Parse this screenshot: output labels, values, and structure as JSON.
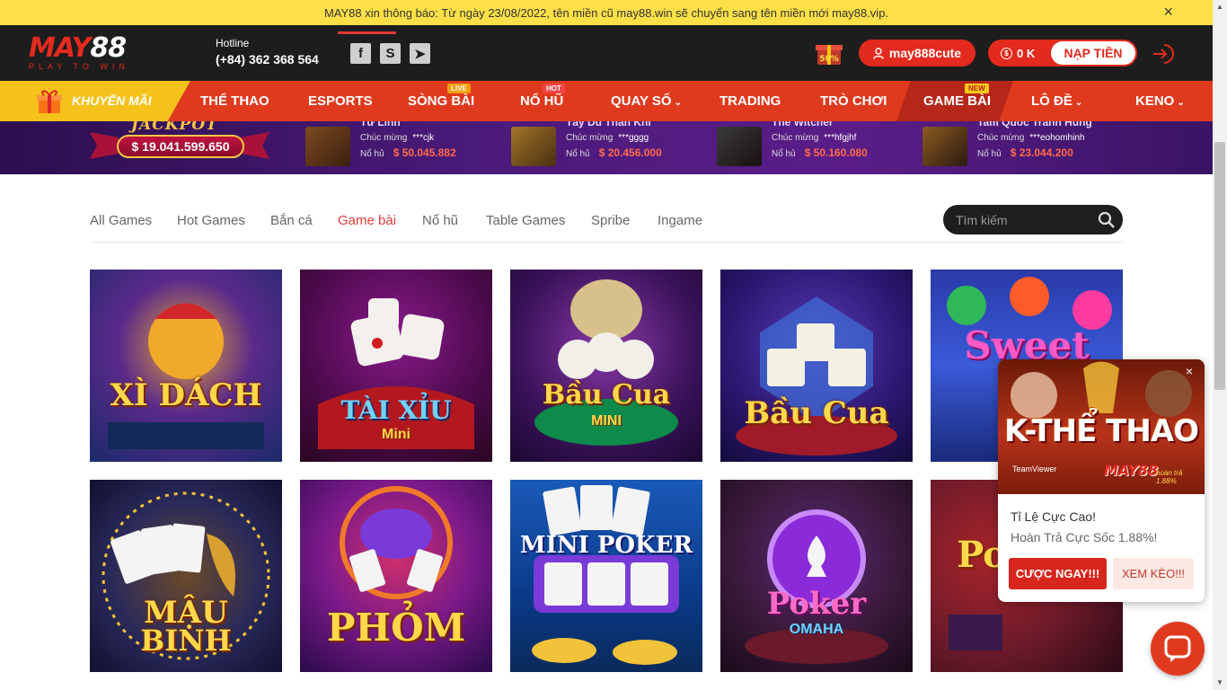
{
  "notice": {
    "text": "MAY88 xin thông báo: Từ ngày 23/08/2022, tên miền cũ may88.win sẽ chuyển sang tên miền mới may88.vip.",
    "close": "×"
  },
  "header": {
    "logo_main": "MAY",
    "logo_num": "88",
    "logo_tag": "PLAY TO WIN",
    "hotline_label": "Hotline",
    "hotline_number": "(+84) 362 368 564",
    "social": [
      "f",
      "S",
      "➤"
    ],
    "promo_badge": "50%",
    "username": "may888cute",
    "balance": "0 K",
    "coin_symbol": "$",
    "deposit_label": "NẠP TIỀN"
  },
  "nav": {
    "promo": "KHUYẾN MÃI",
    "items": [
      "THỂ THAO",
      "ESPORTS",
      "SÒNG BÀI",
      "NỔ HŨ",
      "QUAY SỐ",
      "TRADING",
      "TRÒ CHƠI",
      "GAME BÀI",
      "LÔ ĐỀ",
      "KENO"
    ],
    "chevron": "⌄",
    "badges": {
      "live": "LIVE",
      "hot": "HOT",
      "new": "NEW"
    }
  },
  "jackpot": {
    "title": "JACKPOT",
    "amount": "$ 19.041.599.650",
    "winners": [
      {
        "game": "Tứ Linh",
        "congrats": "Chúc mừng",
        "user": "***cjk",
        "win_label": "Nổ hủ",
        "amount": "$ 50.045.882"
      },
      {
        "game": "Tây Du Thần Khí",
        "congrats": "Chúc mừng",
        "user": "***gggg",
        "win_label": "Nổ hủ",
        "amount": "$ 20.456.000"
      },
      {
        "game": "The Witcher",
        "congrats": "Chúc mừng",
        "user": "***hfgjhf",
        "win_label": "Nổ hủ",
        "amount": "$ 50.160.080"
      },
      {
        "game": "Tam Quốc Tranh Hùng",
        "congrats": "Chúc mừng",
        "user": "***eohomhinh",
        "win_label": "Nổ hủ",
        "amount": "$ 23.044.200"
      }
    ]
  },
  "tabs": [
    "All Games",
    "Hot Games",
    "Bắn cá",
    "Game bài",
    "Nổ hũ",
    "Table Games",
    "Spribe",
    "Ingame"
  ],
  "active_tab": "Game bài",
  "search": {
    "placeholder": "Tìm kiếm"
  },
  "games": [
    {
      "title": "XÌ DÁCH",
      "sub": ""
    },
    {
      "title": "TÀI XỈU",
      "sub": "Mini"
    },
    {
      "title": "Bầu Cua",
      "sub": "MINI"
    },
    {
      "title": "Bầu Cua",
      "sub": ""
    },
    {
      "title": "Sweet Ca",
      "sub": ""
    },
    {
      "title": "MẬU",
      "sub": "BINH"
    },
    {
      "title": "PHỎM",
      "sub": ""
    },
    {
      "title": "MINI POKER",
      "sub": ""
    },
    {
      "title": "Poker",
      "sub": "OMAHA"
    },
    {
      "title": "Po",
      "sub": ""
    }
  ],
  "popup": {
    "title": "K-THỂ THAO",
    "teamviewer": "TeamViewer",
    "brand": "MAY88",
    "brand_tag": "hoàn trả 1.88%",
    "line1": "Tỉ Lệ Cực Cao!",
    "line2": "Hoàn Trả Cực Sốc 1.88%!",
    "btn_bet": "CƯỢC NGAY!!!",
    "btn_view": "XEM KÈO!!!",
    "close": "×"
  },
  "colors": {
    "brand_red": "#e32a1e",
    "nav_red": "#e03a1e",
    "notice_yellow": "#fde047",
    "header_dark": "#1d1d1d",
    "active_tab": "#e03a3a"
  }
}
